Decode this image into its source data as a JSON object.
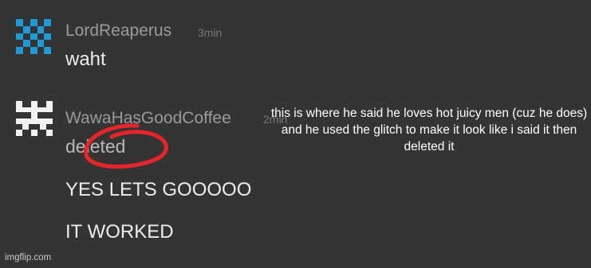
{
  "messages": [
    {
      "username": "LordReaperus",
      "timestamp": "3min",
      "lines": [
        "waht"
      ],
      "avatar_icon": "blue-checker-avatar-icon",
      "avatar_color": "#1e9ad8"
    },
    {
      "username": "WawaHasGoodCoffee",
      "timestamp": "2min",
      "lines": [
        "deleted",
        "YES LETS GOOOOO",
        "IT WORKED"
      ],
      "avatar_icon": "white-glyph-avatar-icon",
      "avatar_color": "#f2f2f2"
    }
  ],
  "caption": "this is where he said he loves hot juicy men (cuz he does) and he used the glitch to make it look like i said it then deleted it",
  "annotation_color": "#e8232a",
  "watermark": "imgflip.com"
}
